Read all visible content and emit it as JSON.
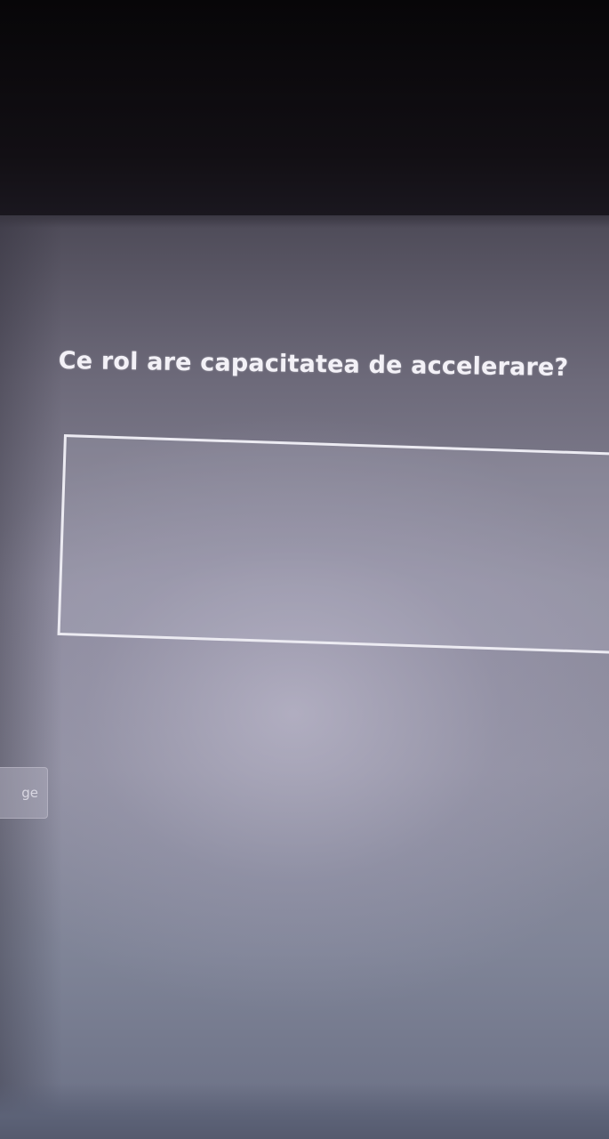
{
  "question": {
    "text": "Ce rol are capacitatea de accelerare?"
  },
  "answer": {
    "value": ""
  },
  "side_button": {
    "label": "ge"
  }
}
